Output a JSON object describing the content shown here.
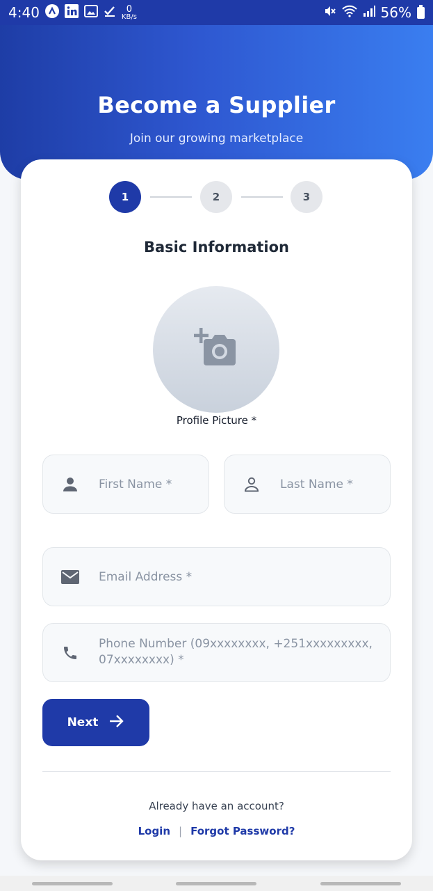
{
  "status_bar": {
    "time": "4:40",
    "net_speed_value": "0",
    "net_speed_unit": "KB/s",
    "battery": "56%",
    "icons": [
      "app-icon",
      "linkedin-icon",
      "image-icon",
      "checkmark-icon",
      "mute-icon",
      "wifi-icon",
      "signal-icon",
      "battery-icon"
    ]
  },
  "header": {
    "title": "Become a Supplier",
    "subtitle": "Join our growing marketplace"
  },
  "stepper": {
    "steps": [
      "1",
      "2",
      "3"
    ],
    "active_step": 1
  },
  "form": {
    "section_title": "Basic Information",
    "profile_picture_label": "Profile Picture *",
    "first_name_placeholder": "First Name *",
    "last_name_placeholder": "Last Name *",
    "email_placeholder": "Email Address *",
    "phone_placeholder": "Phone Number (09xxxxxxxx, +251xxxxxxxxx, 07xxxxxxxx) *",
    "next_label": "Next"
  },
  "footer": {
    "account_question": "Already have an account?",
    "login_label": "Login",
    "separator": "|",
    "forgot_label": "Forgot Password?"
  },
  "colors": {
    "primary": "#1f3aa8",
    "gradient_end": "#3a7ef0",
    "field_bg": "#f7f9fb"
  }
}
